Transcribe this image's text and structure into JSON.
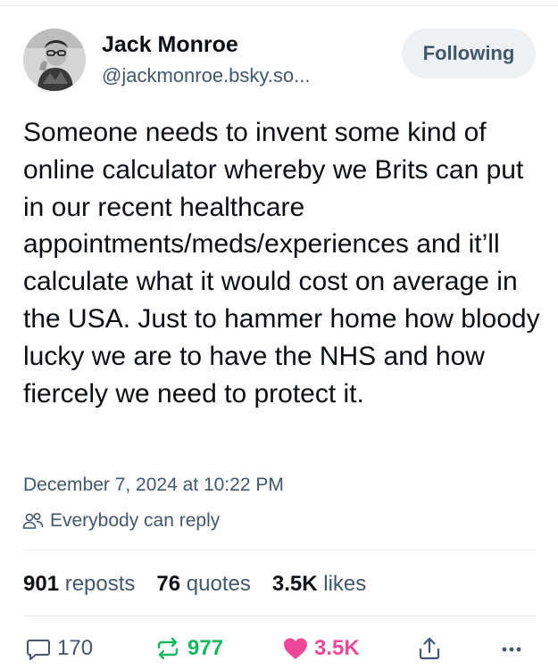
{
  "post": {
    "author": {
      "display_name": "Jack Monroe",
      "handle": "@jackmonroe.bsky.so..."
    },
    "follow_label": "Following",
    "text": "Someone needs to invent some kind of online calculator whereby we Brits can put in our recent healthcare appointments/meds/experiences and it’ll calculate what it would cost on average in the USA. Just to hammer home how bloody lucky we are to have the NHS and how fiercely we need to protect it.",
    "timestamp": "December 7, 2024 at 10:22 PM",
    "reply_setting": "Everybody can reply"
  },
  "stats": {
    "reposts_count": "901",
    "reposts_label": "reposts",
    "quotes_count": "76",
    "quotes_label": "quotes",
    "likes_count": "3.5K",
    "likes_label": "likes"
  },
  "actions": {
    "reply_count": "170",
    "repost_count": "977",
    "like_count": "3.5K"
  },
  "icons": {
    "reply": "speech-bubble-icon",
    "repost": "repost-arrows-icon",
    "like": "heart-icon",
    "share": "share-icon",
    "more": "ellipsis-icon",
    "reply_setting": "people-icon"
  },
  "colors": {
    "text": "#0b0f14",
    "muted": "#42576c",
    "repost_active": "#13b85e",
    "like_active": "#ec4899",
    "follow_bg": "#eef1f4"
  }
}
